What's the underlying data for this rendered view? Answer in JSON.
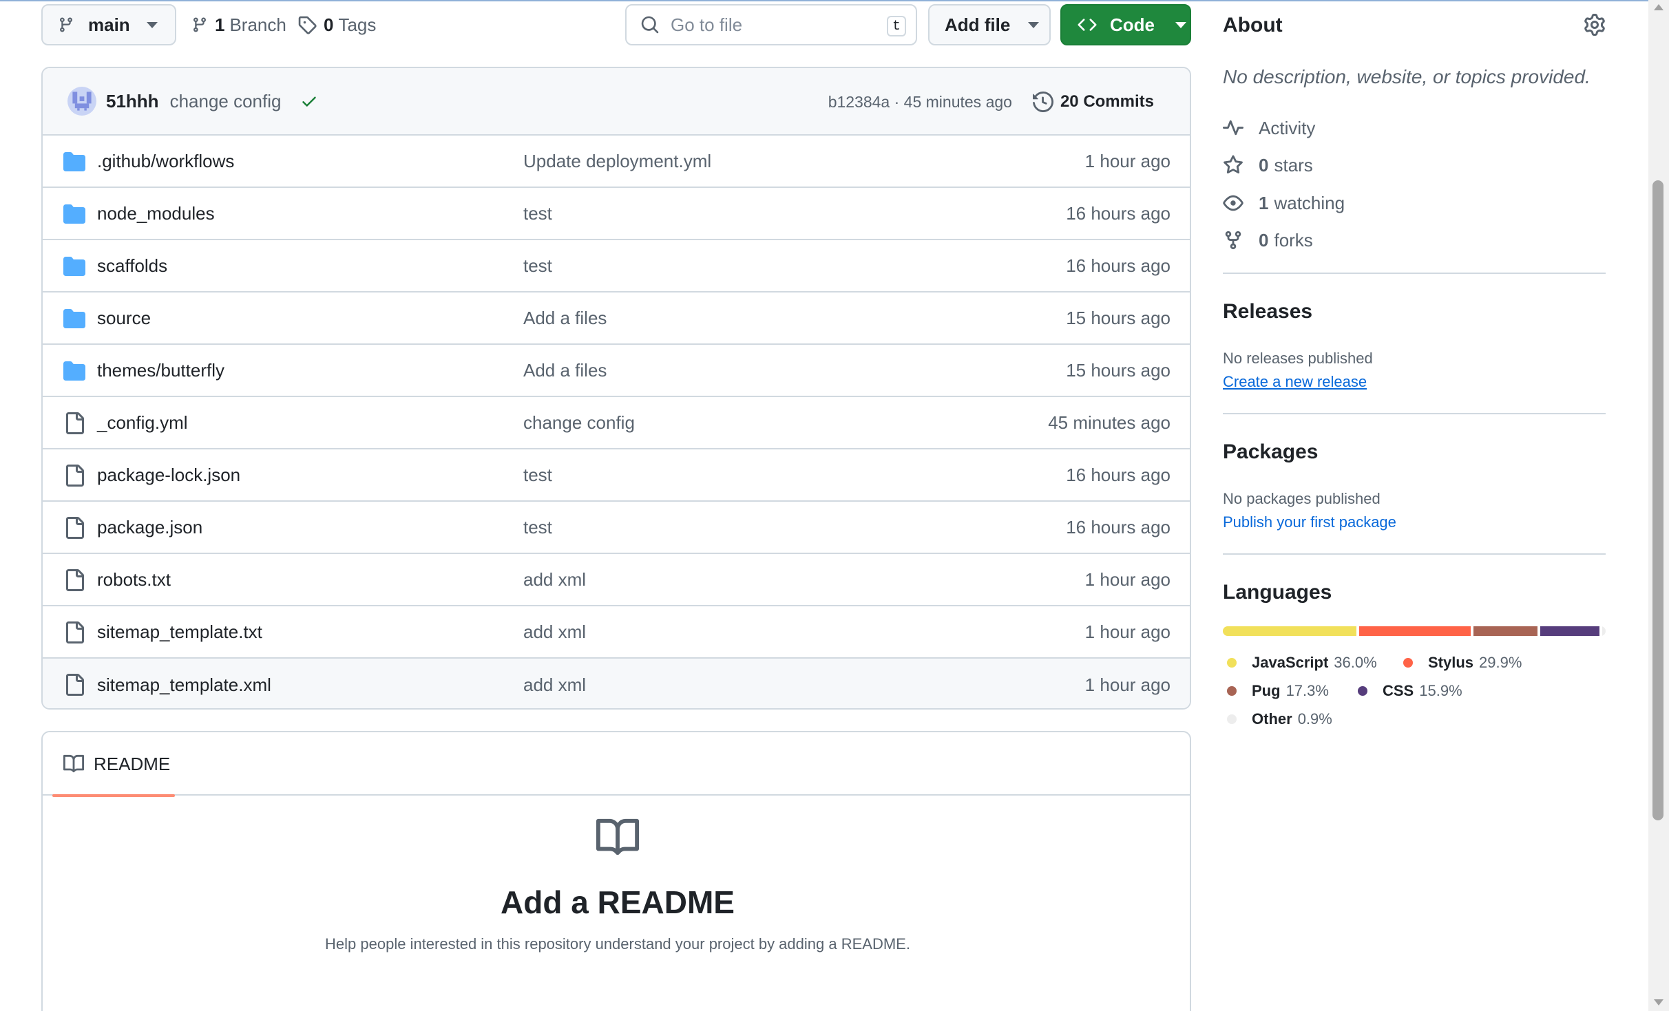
{
  "toolbar": {
    "branch_label": "main",
    "branches_count": "1",
    "branches_label": "Branch",
    "tags_count": "0",
    "tags_label": "Tags",
    "search_placeholder": "Go to file",
    "search_shortcut": "t",
    "add_file_label": "Add file",
    "code_label": "Code"
  },
  "commit": {
    "author": "51hhh",
    "message": "change config",
    "status": "success",
    "hash_time": "b12384a · 45 minutes ago",
    "commits_label": "20 Commits"
  },
  "files": [
    {
      "type": "folder",
      "name": ".github/workflows",
      "message": "Update deployment.yml",
      "date": "1 hour ago"
    },
    {
      "type": "folder",
      "name": "node_modules",
      "message": "test",
      "date": "16 hours ago"
    },
    {
      "type": "folder",
      "name": "scaffolds",
      "message": "test",
      "date": "16 hours ago"
    },
    {
      "type": "folder",
      "name": "source",
      "message": "Add a files",
      "date": "15 hours ago"
    },
    {
      "type": "folder",
      "name": "themes/butterfly",
      "message": "Add a files",
      "date": "15 hours ago"
    },
    {
      "type": "file",
      "name": "_config.yml",
      "message": "change config",
      "date": "45 minutes ago"
    },
    {
      "type": "file",
      "name": "package-lock.json",
      "message": "test",
      "date": "16 hours ago"
    },
    {
      "type": "file",
      "name": "package.json",
      "message": "test",
      "date": "16 hours ago"
    },
    {
      "type": "file",
      "name": "robots.txt",
      "message": "add xml",
      "date": "1 hour ago"
    },
    {
      "type": "file",
      "name": "sitemap_template.txt",
      "message": "add xml",
      "date": "1 hour ago"
    },
    {
      "type": "file",
      "name": "sitemap_template.xml",
      "message": "add xml",
      "date": "1 hour ago"
    }
  ],
  "readme": {
    "tab_label": "README",
    "title": "Add a README",
    "subtitle": "Help people interested in this repository understand your project by adding a README."
  },
  "about": {
    "title": "About",
    "description": "No description, website, or topics provided.",
    "activity_label": "Activity",
    "stars_count": "0",
    "stars_label": "stars",
    "watching_count": "1",
    "watching_label": "watching",
    "forks_count": "0",
    "forks_label": "forks"
  },
  "releases": {
    "title": "Releases",
    "note": "No releases published",
    "link": "Create a new release"
  },
  "packages": {
    "title": "Packages",
    "note": "No packages published",
    "link": "Publish your first package"
  },
  "languages": {
    "title": "Languages",
    "items": [
      {
        "name": "JavaScript",
        "percent": "36.0%",
        "value": 36.0,
        "color": "#f1e05a"
      },
      {
        "name": "Stylus",
        "percent": "29.9%",
        "value": 29.9,
        "color": "#ff6347"
      },
      {
        "name": "Pug",
        "percent": "17.3%",
        "value": 17.3,
        "color": "#a86454"
      },
      {
        "name": "CSS",
        "percent": "15.9%",
        "value": 15.9,
        "color": "#563d7c"
      },
      {
        "name": "Other",
        "percent": "0.9%",
        "value": 0.9,
        "color": "#ededed"
      }
    ]
  },
  "colors": {
    "code_button": "#1f883d",
    "link": "#0969da",
    "folder_icon": "#54aeff",
    "readme_tab_underline": "#fd8c73"
  }
}
